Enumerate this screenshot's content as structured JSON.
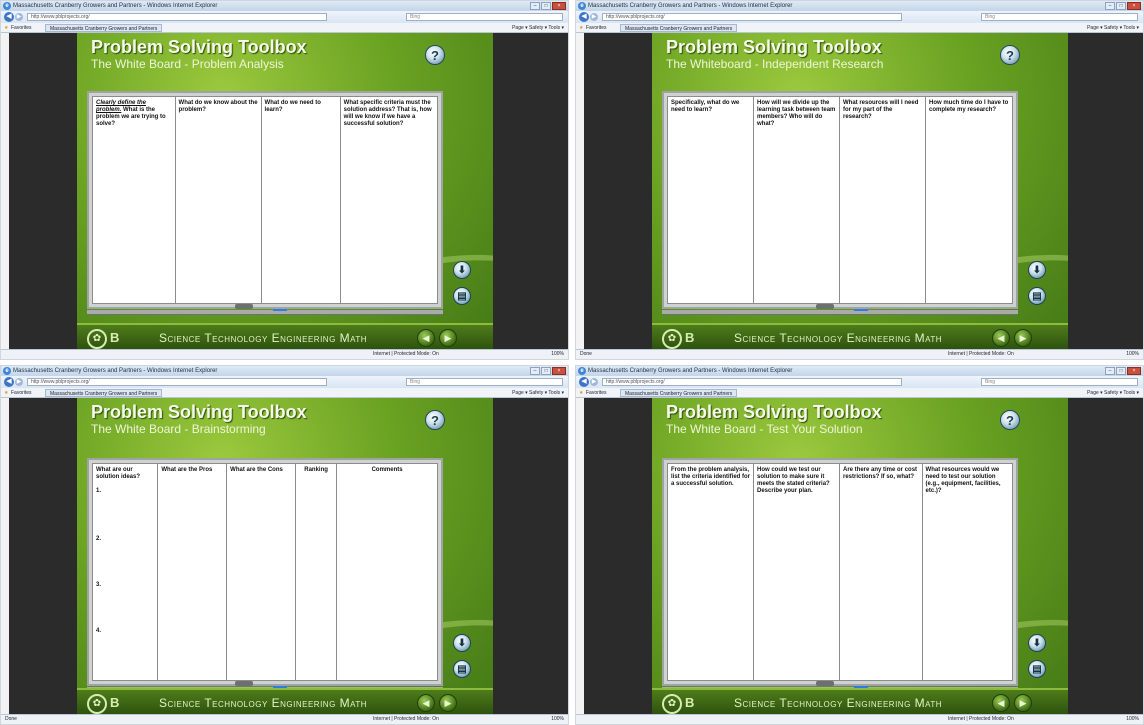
{
  "browser": {
    "window_title": "Massachusetts Cranberry Growers and Partners - Windows Internet Explorer",
    "url": "http://www.pblprojects.org/",
    "search_placeholder": "Bing",
    "favorites_label": "Favorites",
    "tab_title": "Massachusetts Cranberry Growers and Partners",
    "command_bar": "Page ▾  Safety ▾  Tools ▾",
    "status_left": "Done",
    "status_zone": "Internet | Protected Mode: On",
    "status_zoom": "100%"
  },
  "app": {
    "title": "Problem Solving Toolbox",
    "footer_text": "Science Technology Engineering Math",
    "footer_logo_letter": "B"
  },
  "panels": [
    {
      "subtitle": "The White Board - Problem Analysis",
      "columns": [
        {
          "emph": "Clearly define the problem.",
          "text": " What is the problem we are trying to solve?"
        },
        {
          "text": "What do we know about the problem?"
        },
        {
          "text": "What do we need to learn?"
        },
        {
          "text": "What specific criteria must the solution address? That is, how will we know if we have a successful solution?"
        }
      ]
    },
    {
      "subtitle": "The Whiteboard - Independent Research",
      "columns": [
        {
          "text": "Specifically, what do we need to learn?"
        },
        {
          "text": "How will we divide up the learning task between team members? Who will do what?"
        },
        {
          "text": "What resources will I need for my part of the research?"
        },
        {
          "text": "How much time do I have to complete my research?"
        }
      ]
    },
    {
      "subtitle": "The White Board - Brainstorming",
      "columns": [
        {
          "text": "What are our solution ideas?"
        },
        {
          "text": "What are the Pros"
        },
        {
          "text": "What are the Cons"
        },
        {
          "text": "Ranking"
        },
        {
          "text": "Comments"
        }
      ],
      "numbers": [
        "1.",
        "2.",
        "3.",
        "4."
      ]
    },
    {
      "subtitle": "The White Board - Test Your Solution",
      "columns": [
        {
          "text": "From the problem analysis, list the criteria identified for a successful solution."
        },
        {
          "text": "How could we test our solution to make sure it meets the stated criteria? Describe your plan."
        },
        {
          "text": "Are there any time or cost restrictions? If so, what?"
        },
        {
          "text": "What resources would we need to test our solution (e.g., equipment, facilities, etc.)?"
        }
      ]
    }
  ],
  "icons": {
    "help": "question-icon",
    "download": "download-icon",
    "print": "printer-icon",
    "nav_back": "arrow-left-icon",
    "nav_forward": "arrow-right-icon"
  }
}
